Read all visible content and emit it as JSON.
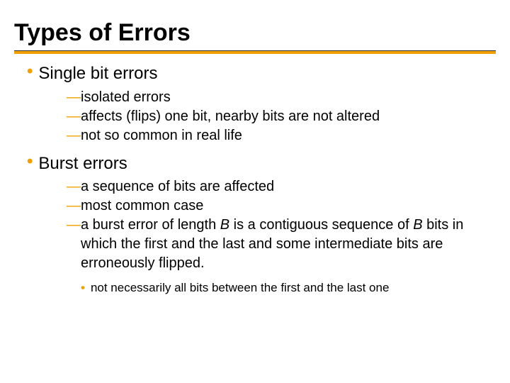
{
  "colors": {
    "accent": "#f0a000"
  },
  "title": "Types of Errors",
  "sections": [
    {
      "heading": "Single bit errors",
      "items": [
        {
          "text": "isolated errors"
        },
        {
          "text": "affects (flips) one bit, nearby bits are not altered"
        },
        {
          "text": "not so common in real life"
        }
      ],
      "subnote": null
    },
    {
      "heading": "Burst errors",
      "items": [
        {
          "text": "a sequence of bits are affected"
        },
        {
          "text": "most common case"
        },
        {
          "html": "a burst error of length <span class=\"italic\">B</span> is a contiguous sequence of <span class=\"italic\">B</span> bits in which the first and the last and some intermediate bits are erroneously flipped."
        }
      ],
      "subnote": "not necessarily all bits between the first and the last one"
    }
  ]
}
